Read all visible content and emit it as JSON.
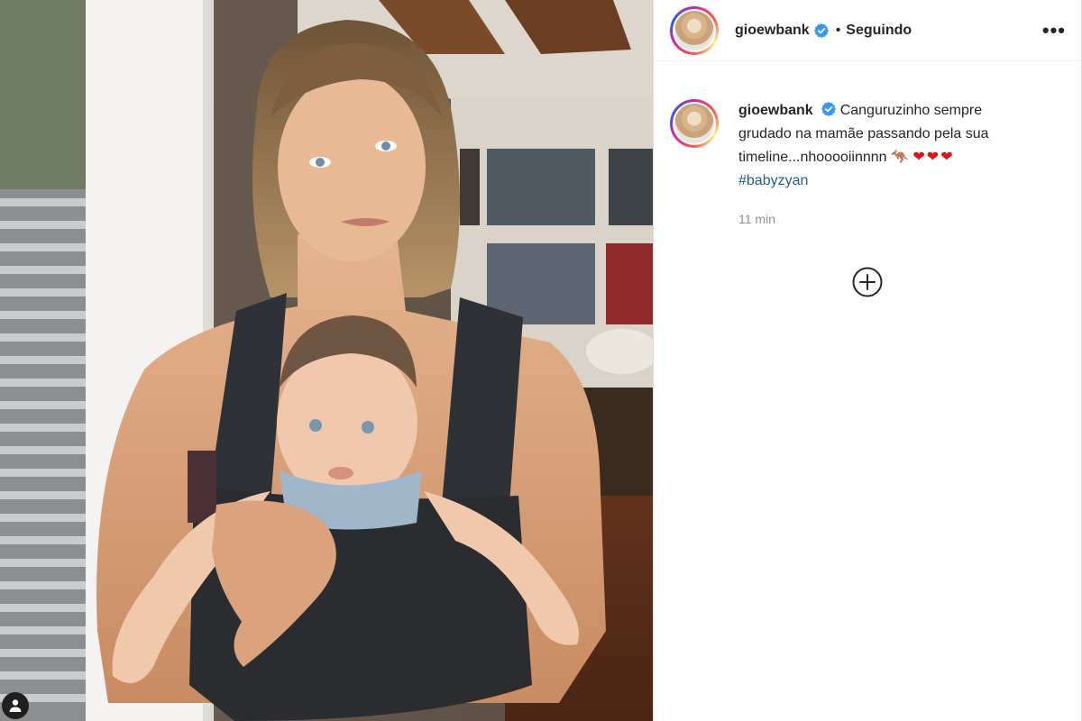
{
  "header": {
    "username": "gioewbank",
    "verified_icon": "verified-badge-icon",
    "separator": "•",
    "follow_status": "Seguindo",
    "more_label": "•••"
  },
  "caption": {
    "username": "gioewbank",
    "text": "Canguruzinho sempre grudado na mamãe passando pela sua timeline...nhooooiinnnn",
    "emoji_kangaroo": "🦘",
    "emoji_hearts": "❤❤❤",
    "hashtag": "#babyzyan",
    "timestamp": "11 min"
  },
  "colors": {
    "verified_blue": "#3897f0",
    "hashtag_blue": "#1f5b9a",
    "text": "#262626",
    "muted": "#8e8e8e"
  },
  "icons": {
    "add": "plus-circle-icon",
    "tag": "user-tag-icon"
  }
}
